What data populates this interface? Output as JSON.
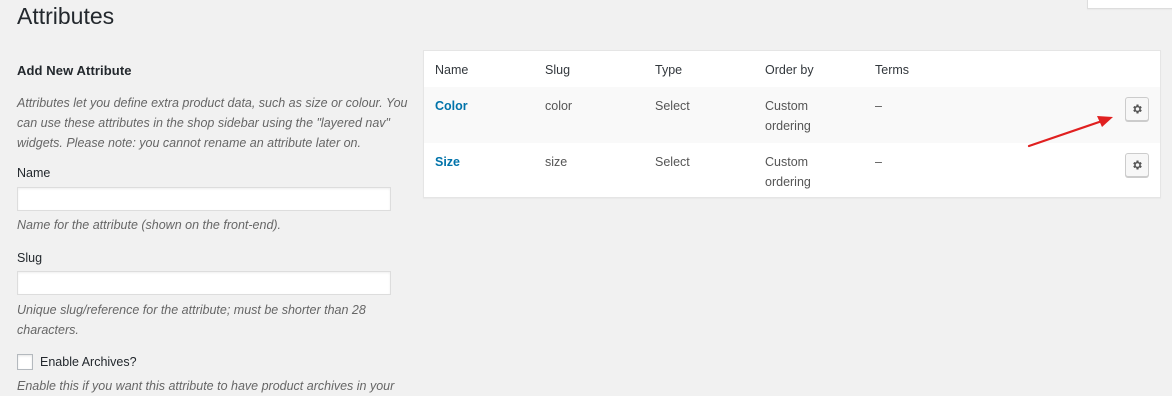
{
  "page": {
    "title": "Attributes"
  },
  "form": {
    "heading": "Add New Attribute",
    "intro": "Attributes let you define extra product data, such as size or colour. You can use these attributes in the shop sidebar using the \"layered nav\" widgets. Please note: you cannot rename an attribute later on.",
    "name_label": "Name",
    "name_value": "",
    "name_placeholder": "",
    "name_desc": "Name for the attribute (shown on the front-end).",
    "slug_label": "Slug",
    "slug_value": "",
    "slug_placeholder": "",
    "slug_desc": "Unique slug/reference for the attribute; must be shorter than 28 characters.",
    "archives_label": "Enable Archives?",
    "archives_checked": false,
    "archives_desc": "Enable this if you want this attribute to have product archives in your"
  },
  "table": {
    "columns": [
      "Name",
      "Slug",
      "Type",
      "Order by",
      "Terms"
    ],
    "rows": [
      {
        "name": "Color",
        "slug": "color",
        "type": "Select",
        "order": "Custom ordering",
        "terms": "–"
      },
      {
        "name": "Size",
        "slug": "size",
        "type": "Select",
        "order": "Custom ordering",
        "terms": "–"
      }
    ]
  },
  "icons": {
    "row_action": "gear-icon",
    "annotation": "red-arrow-icon"
  },
  "colors": {
    "link": "#0073aa",
    "annotation": "#e02020",
    "background": "#f1f1f1"
  }
}
